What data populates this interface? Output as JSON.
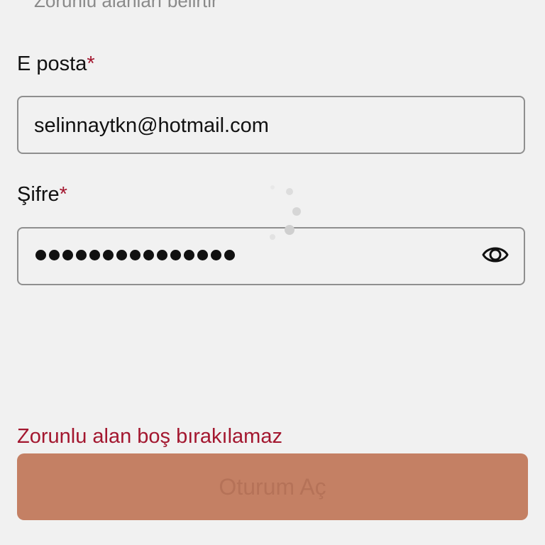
{
  "form": {
    "required_note": "Zorunlu alanları belirtir",
    "email": {
      "label": "E posta",
      "required_mark": "*",
      "value": "selinnaytkn@hotmail.com"
    },
    "password": {
      "label": "Şifre",
      "required_mark": "*",
      "masked_length": 15,
      "visibility_icon": "eye-icon"
    },
    "error_message": "Zorunlu alan boş bırakılamaz",
    "submit_label": "Oturum Aç"
  },
  "colors": {
    "background": "#f1f1f1",
    "accent_red": "#a3172f",
    "button_bg": "#c48064",
    "button_text": "#b57258",
    "border": "#8f8f8f"
  },
  "loading": true
}
